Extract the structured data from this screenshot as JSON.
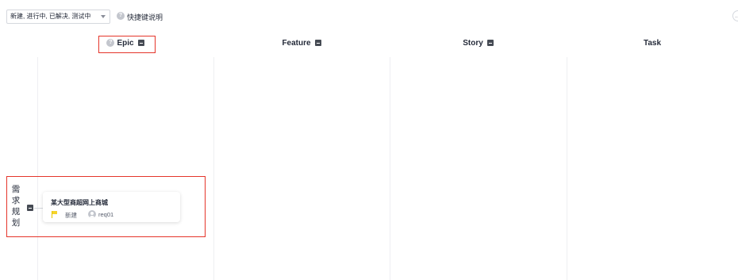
{
  "toolbar": {
    "status_filter": "新建, 进行中, 已解决, 测试中",
    "shortcut_help": "快捷键说明",
    "help_icon_glyph": "?"
  },
  "columns": [
    {
      "label": "Epic",
      "has_help_icon": true,
      "collapsible": true
    },
    {
      "label": "Feature",
      "collapsible": true
    },
    {
      "label": "Story",
      "collapsible": true
    },
    {
      "label": "Task",
      "collapsible": false
    }
  ],
  "swimlane": {
    "label_chars": [
      "需",
      "求",
      "规",
      "划"
    ]
  },
  "card": {
    "title": "某大型商超网上商城",
    "status": "新建",
    "owner": "req01",
    "flag_color": "#f5d32a"
  },
  "icons": {
    "help": "question-circle-icon",
    "collapse": "minus-square-icon",
    "flag": "flag-icon",
    "avatar": "user-avatar-icon",
    "dropdown": "caret-down-icon"
  },
  "colors": {
    "highlight": "#e5352b",
    "collapse_button": "#464b54",
    "grid_line": "#eeeff2"
  }
}
